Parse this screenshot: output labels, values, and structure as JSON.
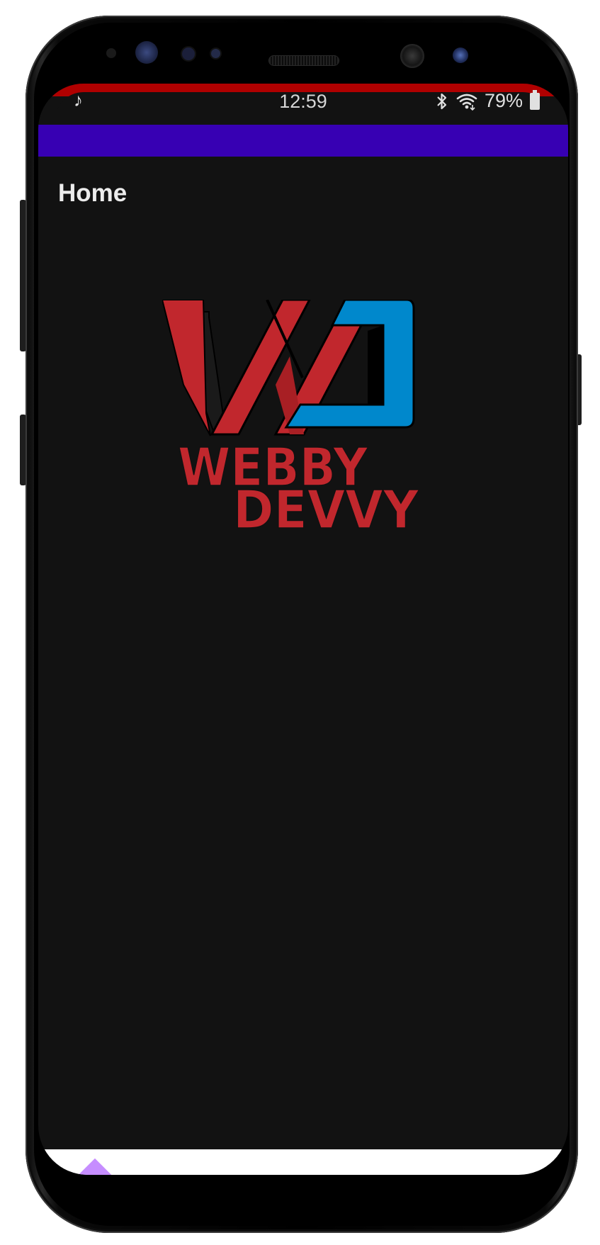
{
  "statusbar": {
    "time": "12:59",
    "battery_percent": "79%",
    "music_icon": "music-note-icon",
    "bluetooth_icon": "bluetooth-icon",
    "wifi_icon": "wifi-icon",
    "battery_icon": "battery-icon"
  },
  "appbar": {
    "color": "#3700b3"
  },
  "page": {
    "title": "Home",
    "background": "#121212"
  },
  "logo": {
    "line1": "WEBBY",
    "line2": "DEVVY",
    "red": "#c1272d",
    "blue": "#0088cc"
  },
  "bottom_nav": {
    "background": "#ffffff",
    "accent": "#c68dff"
  }
}
